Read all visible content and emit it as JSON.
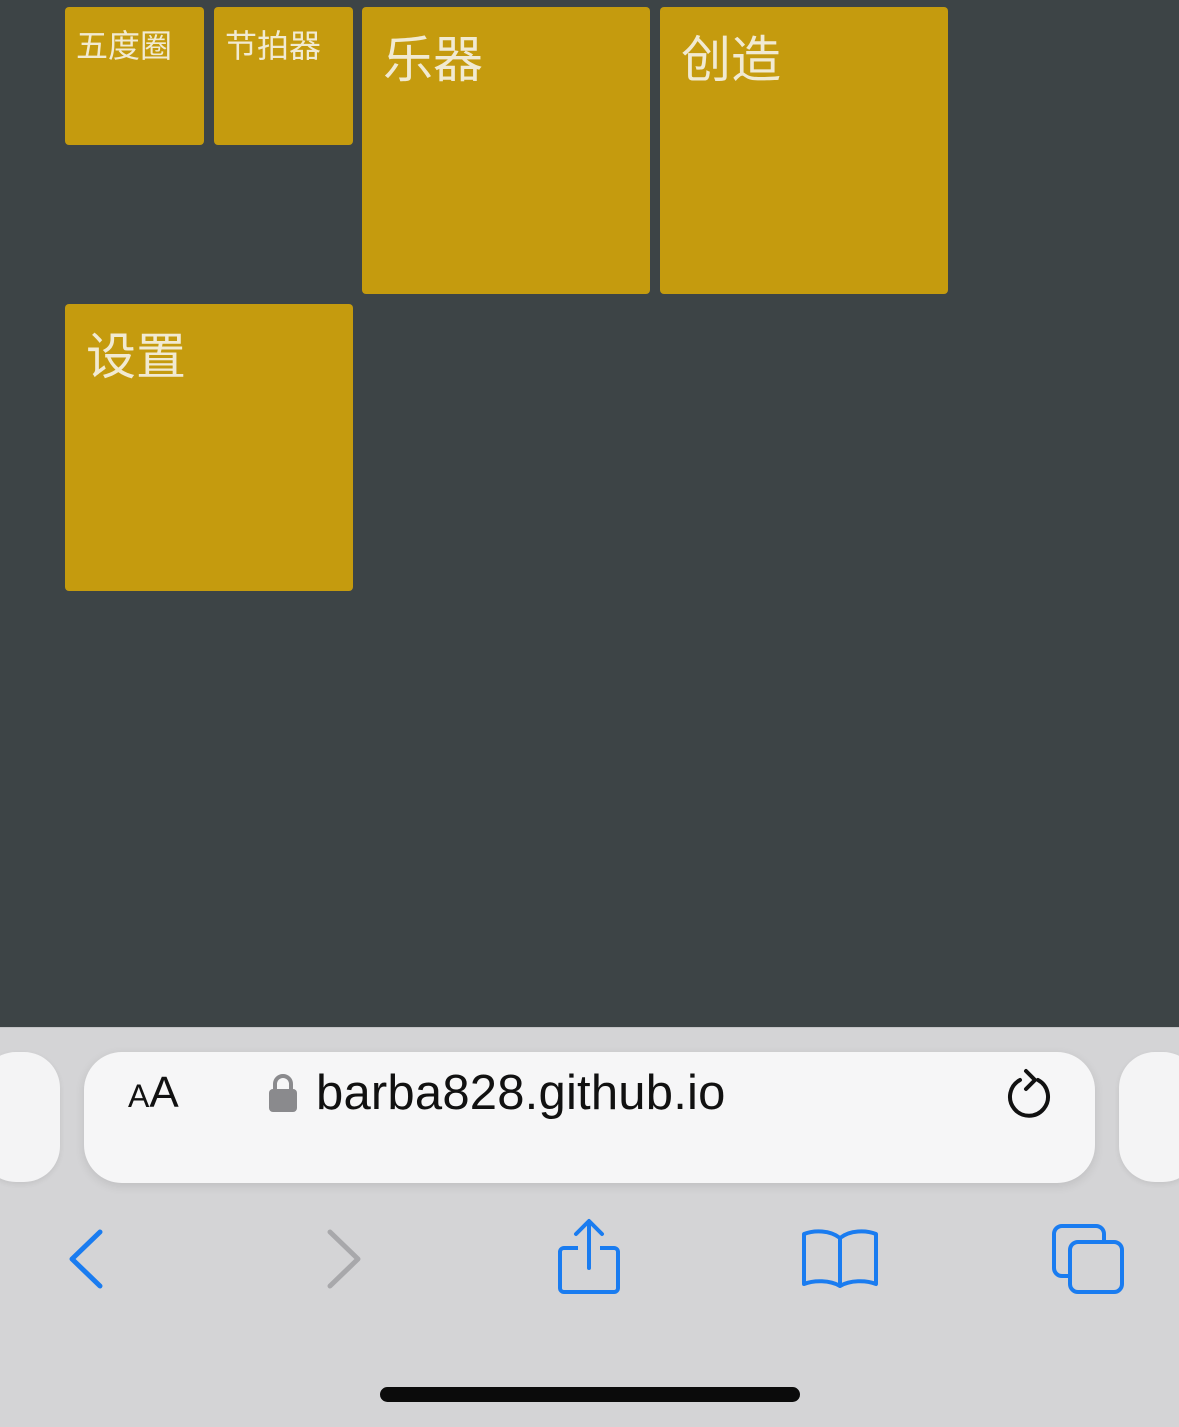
{
  "tiles": [
    {
      "label": "五度圈"
    },
    {
      "label": "节拍器"
    },
    {
      "label": "乐器"
    },
    {
      "label": "创造"
    },
    {
      "label": "设置"
    }
  ],
  "browser": {
    "text_size_button_small": "A",
    "text_size_button_large": "A",
    "url": "barba828.github.io"
  },
  "icons": {
    "lock": "lock-icon",
    "reload": "reload-icon",
    "back": "chevron-left-icon",
    "forward": "chevron-right-icon",
    "share": "share-icon",
    "bookmarks": "book-icon",
    "tabs": "tabs-icon"
  },
  "colors": {
    "background": "#3d4446",
    "tile": "#c59b0e",
    "tile_text": "#f1ead2",
    "accent": "#1a7cf0",
    "disabled": "#a8a8ab"
  }
}
